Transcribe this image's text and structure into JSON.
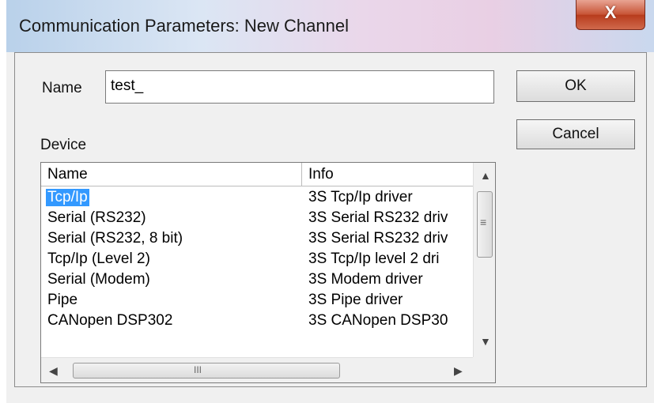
{
  "window": {
    "title": "Communication Parameters: New Channel",
    "close_label": "X"
  },
  "form": {
    "name_label": "Name",
    "name_value": "test_",
    "device_label": "Device"
  },
  "buttons": {
    "ok": "OK",
    "cancel": "Cancel"
  },
  "device_list": {
    "columns": [
      "Name",
      "Info"
    ],
    "rows": [
      {
        "name": "Tcp/Ip",
        "info": "3S Tcp/Ip driver",
        "selected": true
      },
      {
        "name": "Serial (RS232)",
        "info": "3S Serial RS232 driv"
      },
      {
        "name": "Serial (RS232, 8 bit)",
        "info": "3S Serial RS232 driv"
      },
      {
        "name": "Tcp/Ip (Level 2)",
        "info": "3S Tcp/Ip level 2 dri"
      },
      {
        "name": "Serial (Modem)",
        "info": "3S Modem driver"
      },
      {
        "name": "Pipe",
        "info": "3S Pipe driver"
      },
      {
        "name": "CANopen DSP302",
        "info": "3S CANopen DSP30"
      }
    ],
    "scrollbar": {
      "up": "▲",
      "down": "▼",
      "left": "◀",
      "right": "▶",
      "grip_v": "≡",
      "grip_h": "III"
    }
  },
  "colors": {
    "selection": "#3399ff",
    "close_button": "#c75335"
  }
}
